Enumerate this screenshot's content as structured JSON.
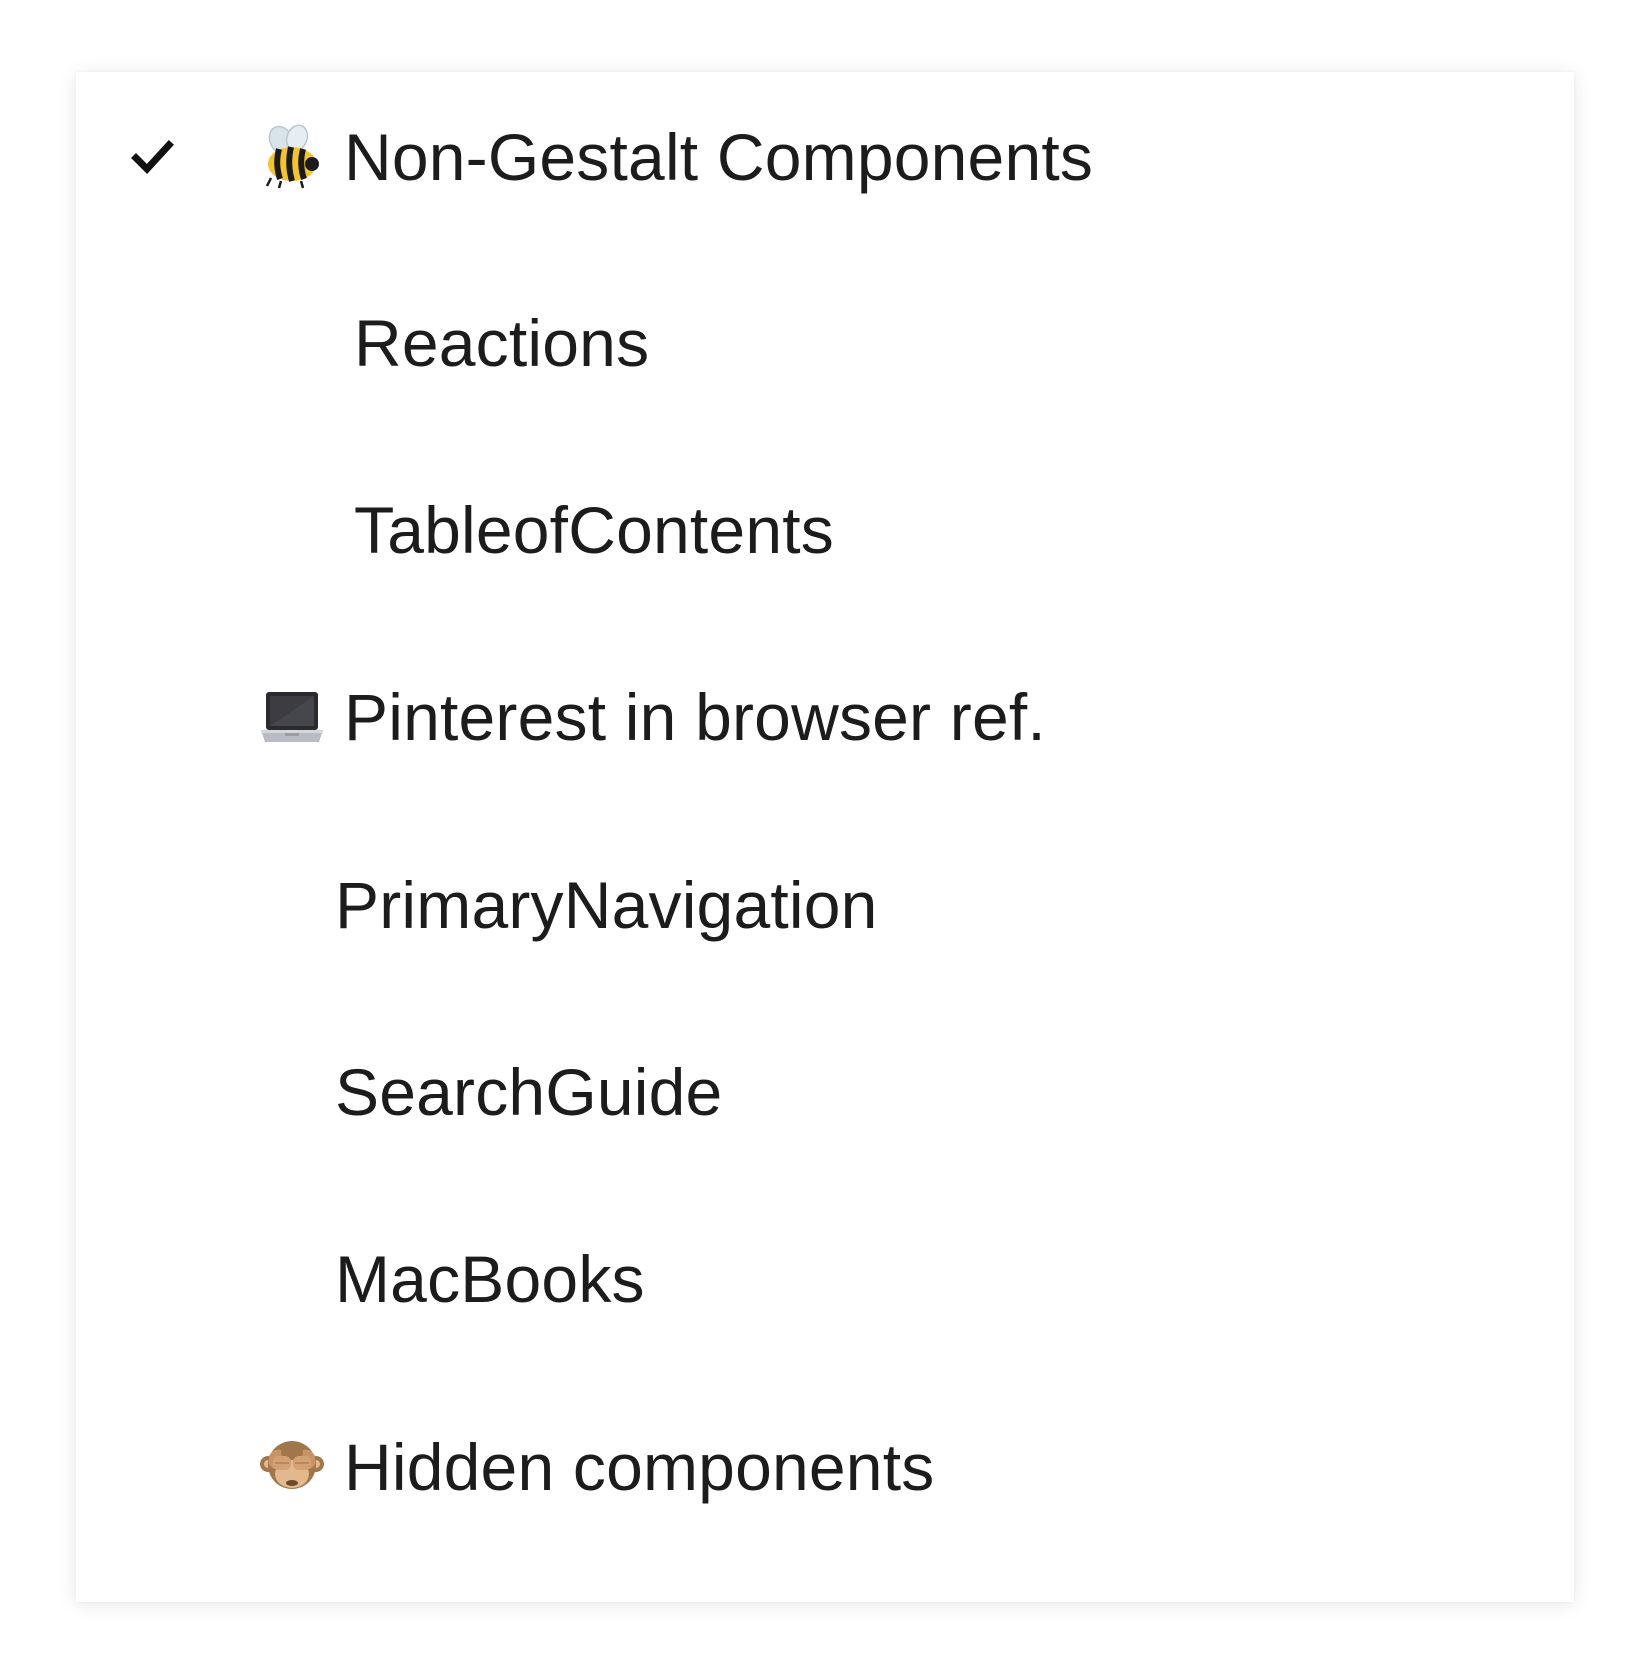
{
  "menu": {
    "items": [
      {
        "type": "group",
        "label": "Non-Gestalt Components",
        "icon": "bee-icon",
        "checked": true
      },
      {
        "type": "option",
        "label": "Reactions"
      },
      {
        "type": "option",
        "label": "TableofContents"
      },
      {
        "type": "group",
        "label": "Pinterest in browser ref.",
        "icon": "laptop-icon",
        "checked": false
      },
      {
        "type": "option",
        "label": "PrimaryNavigation"
      },
      {
        "type": "option",
        "label": "SearchGuide"
      },
      {
        "type": "option",
        "label": "MacBooks"
      },
      {
        "type": "group",
        "label": "Hidden components",
        "icon": "see-no-evil-monkey-icon",
        "checked": false
      }
    ]
  }
}
